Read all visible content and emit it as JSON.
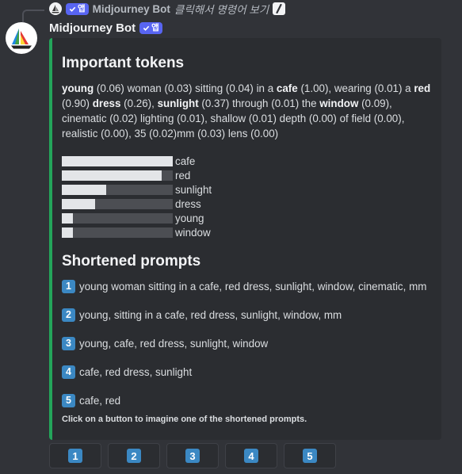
{
  "reply": {
    "bot_name": "Midjourney Bot",
    "badge_label": "앱",
    "command_text": "클릭해서 명령어 보기"
  },
  "message": {
    "author": "Midjourney Bot",
    "badge_label": "앱",
    "accent_color": "#23a55a"
  },
  "embed": {
    "title": "Important tokens",
    "description": [
      {
        "text": "young",
        "bold": true
      },
      {
        "text": " (0.06) woman (0.03) sitting (0.04) in a ",
        "bold": false
      },
      {
        "text": "cafe",
        "bold": true
      },
      {
        "text": " (1.00), wearing (0.01) a ",
        "bold": false
      },
      {
        "text": "red",
        "bold": true
      },
      {
        "text": " (0.90) ",
        "bold": false
      },
      {
        "text": "dress",
        "bold": true
      },
      {
        "text": " (0.26), ",
        "bold": false
      },
      {
        "text": "sunlight",
        "bold": true
      },
      {
        "text": " (0.37) through (0.01) the ",
        "bold": false
      },
      {
        "text": "window",
        "bold": true
      },
      {
        "text": " (0.09), cinematic (0.02) lighting (0.01), shallow (0.01) depth (0.00) of field (0.00), realistic (0.00), 35 (0.02)mm (0.03) lens (0.00)",
        "bold": false
      }
    ],
    "token_bars": [
      {
        "label": "cafe",
        "value": 1.0
      },
      {
        "label": "red",
        "value": 0.9
      },
      {
        "label": "sunlight",
        "value": 0.4
      },
      {
        "label": "dress",
        "value": 0.3
      },
      {
        "label": "young",
        "value": 0.1
      },
      {
        "label": "window",
        "value": 0.1
      }
    ],
    "shortened_title": "Shortened prompts",
    "prompts": [
      {
        "num": "1",
        "text": "young woman sitting in a cafe, red dress, sunlight, window, cinematic, mm"
      },
      {
        "num": "2",
        "text": "young, sitting in a cafe, red dress, sunlight, window, mm"
      },
      {
        "num": "3",
        "text": "young, cafe, red dress, sunlight, window"
      },
      {
        "num": "4",
        "text": "cafe, red dress, sunlight"
      },
      {
        "num": "5",
        "text": "cafe, red"
      }
    ],
    "footer": "Click on a button to imagine one of the shortened prompts."
  },
  "buttons": [
    "1",
    "2",
    "3",
    "4",
    "5"
  ],
  "icons": {
    "avatar": "midjourney-sailboat-icon",
    "slash": "slash-command-icon",
    "badge": "checkmark-icon",
    "number_badge": "keycap-number-icon"
  }
}
